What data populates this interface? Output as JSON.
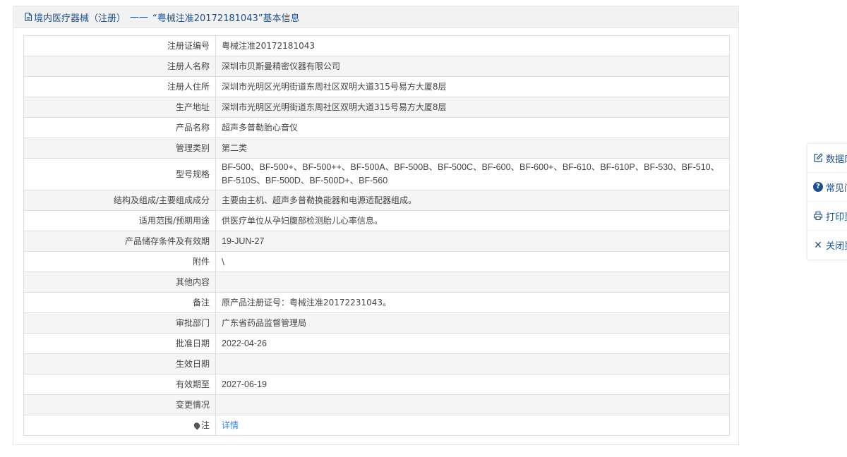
{
  "panel": {
    "header_prefix": "境内医疗器械（注册）",
    "header_dash": "——",
    "header_title": "“粤械注准20172181043”基本信息"
  },
  "rows": [
    {
      "label": "注册证编号",
      "value": "粤械注准20172181043"
    },
    {
      "label": "注册人名称",
      "value": "深圳市贝斯曼精密仪器有限公司"
    },
    {
      "label": "注册人住所",
      "value": "深圳市光明区光明街道东周社区双明大道315号易方大厦8层"
    },
    {
      "label": "生产地址",
      "value": "深圳市光明区光明街道东周社区双明大道315号易方大厦8层"
    },
    {
      "label": "产品名称",
      "value": "超声多普勒胎心音仪"
    },
    {
      "label": "管理类别",
      "value": "第二类"
    },
    {
      "label": "型号规格",
      "value": "BF-500、BF-500+、BF-500++、BF-500A、BF-500B、BF-500C、BF-600、BF-600+、BF-610、BF-610P、BF-530、BF-510、BF-510S、BF-500D、BF-500D+、BF-560"
    },
    {
      "label": "结构及组成/主要组成成分",
      "value": "主要由主机、超声多普勒换能器和电源适配器组成。"
    },
    {
      "label": "适用范围/预期用途",
      "value": "供医疗单位从孕妇腹部检测胎儿心率信息。"
    },
    {
      "label": "产品储存条件及有效期",
      "value": "19-JUN-27"
    },
    {
      "label": "附件",
      "value": "\\"
    },
    {
      "label": "其他内容",
      "value": ""
    },
    {
      "label": "备注",
      "value": "原产品注册证号：粤械注准20172231043。"
    },
    {
      "label": "审批部门",
      "value": "广东省药品监督管理局"
    },
    {
      "label": "批准日期",
      "value": "2022-04-26"
    },
    {
      "label": "生效日期",
      "value": ""
    },
    {
      "label": "有效期至",
      "value": "2027-06-19"
    },
    {
      "label": "变更情况",
      "value": ""
    },
    {
      "label": "注",
      "value": "详情"
    }
  ],
  "side_toolbar": {
    "items": [
      {
        "label": "数据库",
        "icon": "edit-icon"
      },
      {
        "label": "常见问题",
        "icon": "question-icon"
      },
      {
        "label": "打印页面",
        "icon": "printer-icon"
      },
      {
        "label": "关闭页面",
        "icon": "close-icon"
      }
    ]
  },
  "colors": {
    "accent": "#1e4f8f",
    "link": "#2e7ee0",
    "header_bg": "#f2f2f2",
    "row_alt_bg": "#f5f5f5",
    "border": "#dddddd"
  }
}
